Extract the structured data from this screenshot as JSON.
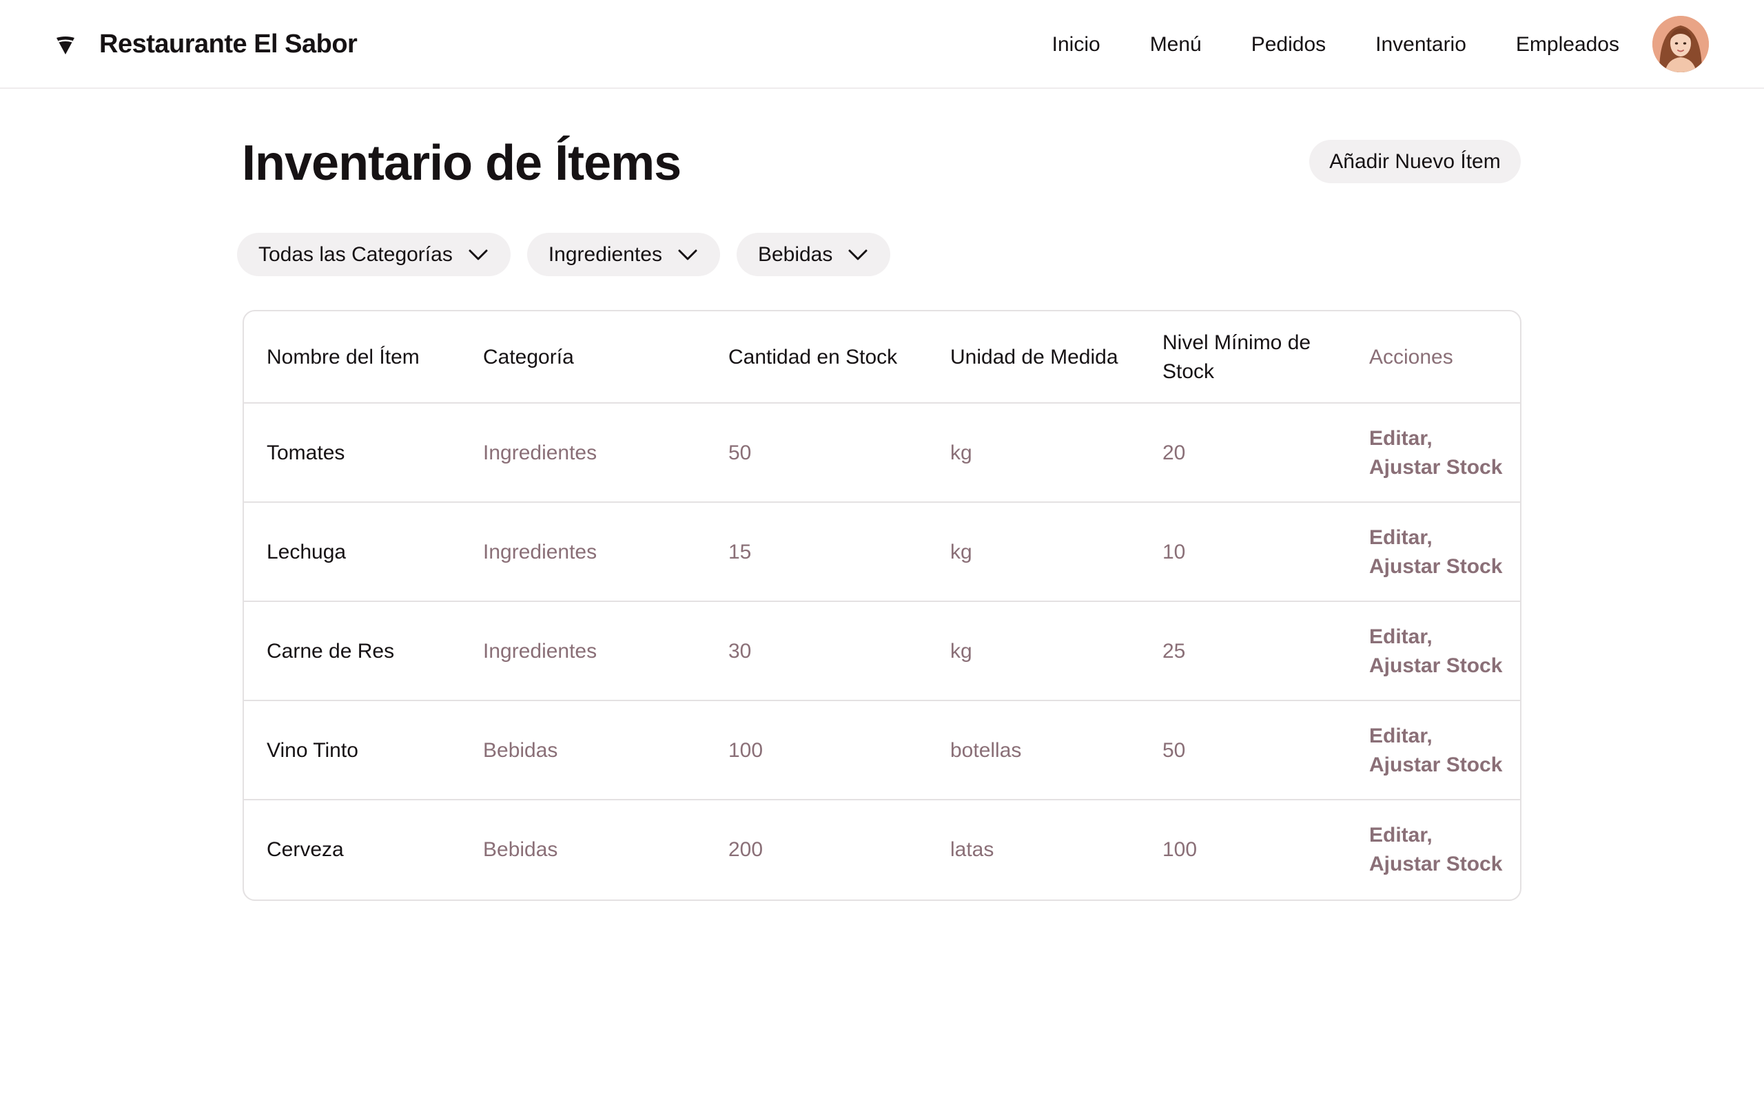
{
  "header": {
    "brand": "Restaurante El Sabor",
    "brand_icon": "restaurant-logo-icon",
    "nav": [
      "Inicio",
      "Menú",
      "Pedidos",
      "Inventario",
      "Empleados"
    ],
    "avatar": "user-avatar"
  },
  "main": {
    "title": "Inventario de Ítems",
    "add_button": "Añadir Nuevo Ítem",
    "filters": [
      {
        "label": "Todas las Categorías",
        "icon": "chevron-down-icon"
      },
      {
        "label": "Ingredientes",
        "icon": "chevron-down-icon"
      },
      {
        "label": "Bebidas",
        "icon": "chevron-down-icon"
      }
    ]
  },
  "table": {
    "columns": [
      "Nombre del Ítem",
      "Categoría",
      "Cantidad en Stock",
      "Unidad de Medida",
      "Nivel Mínimo de Stock",
      "Acciones"
    ],
    "rows": [
      {
        "name": "Tomates",
        "category": "Ingredientes",
        "qty": "50",
        "unit": "kg",
        "min": "20",
        "edit": "Editar,",
        "adjust": "Ajustar Stock"
      },
      {
        "name": "Lechuga",
        "category": "Ingredientes",
        "qty": "15",
        "unit": "kg",
        "min": "10",
        "edit": "Editar,",
        "adjust": "Ajustar Stock"
      },
      {
        "name": "Carne de Res",
        "category": "Ingredientes",
        "qty": "30",
        "unit": "kg",
        "min": "25",
        "edit": "Editar,",
        "adjust": "Ajustar Stock"
      },
      {
        "name": "Vino Tinto",
        "category": "Bebidas",
        "qty": "100",
        "unit": "botellas",
        "min": "50",
        "edit": "Editar,",
        "adjust": "Ajustar Stock"
      },
      {
        "name": "Cerveza",
        "category": "Bebidas",
        "qty": "200",
        "unit": "latas",
        "min": "100",
        "edit": "Editar,",
        "adjust": "Ajustar Stock"
      }
    ]
  },
  "colors": {
    "text": "#161214",
    "muted": "#8a6f77",
    "pill_bg": "#f2f0f1",
    "border": "#e4e1e2"
  }
}
